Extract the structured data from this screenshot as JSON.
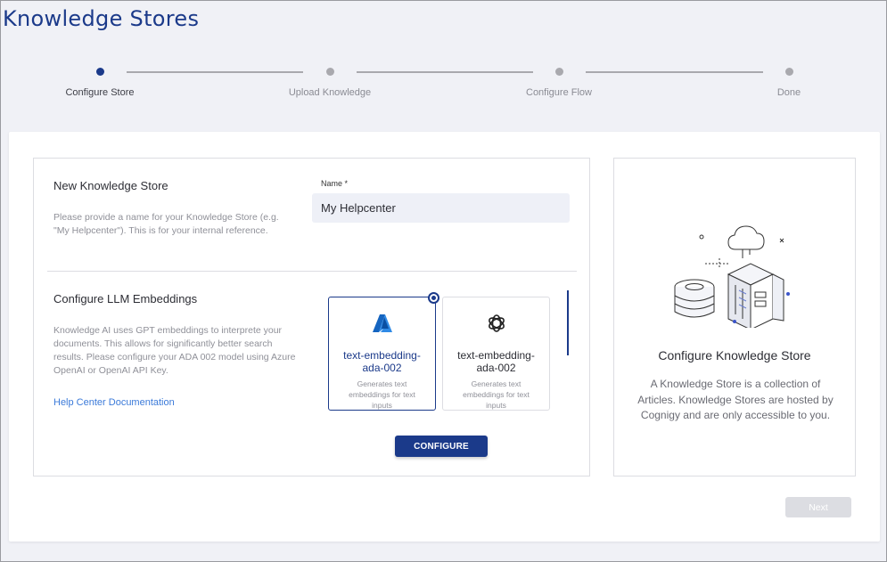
{
  "page": {
    "title": "Knowledge Stores"
  },
  "stepper": {
    "steps": [
      {
        "label": "Configure Store",
        "active": true
      },
      {
        "label": "Upload Knowledge",
        "active": false
      },
      {
        "label": "Configure Flow",
        "active": false
      },
      {
        "label": "Done",
        "active": false
      }
    ]
  },
  "store_section": {
    "title": "New Knowledge Store",
    "description": "Please provide a name for your Knowledge Store (e.g. \"My Helpcenter\"). This is for your internal reference.",
    "name_label": "Name *",
    "name_value": "My Helpcenter"
  },
  "embeddings_section": {
    "title": "Configure LLM Embeddings",
    "description": "Knowledge AI uses GPT embeddings to interprete your documents. This allows for significantly better search results. Please configure your ADA 002 model using Azure OpenAI or OpenAI API Key.",
    "help_link": "Help Center Documentation",
    "options": [
      {
        "provider_icon": "azure-icon",
        "title": "text-embedding-ada-002",
        "description": "Generates text embeddings for text inputs",
        "selected": true
      },
      {
        "provider_icon": "openai-icon",
        "title": "text-embedding-ada-002",
        "description": "Generates text embeddings for text inputs",
        "selected": false
      }
    ],
    "configure_button": "CONFIGURE"
  },
  "info_card": {
    "title": "Configure Knowledge Store",
    "description": "A Knowledge Store is a collection of Articles. Knowledge Stores are hosted by Cognigy and are only accessible to you."
  },
  "footer": {
    "next_button": "Next"
  },
  "colors": {
    "accent": "#1b3a8a",
    "link": "#3b7ad9",
    "disabled": "#dcdde2"
  }
}
